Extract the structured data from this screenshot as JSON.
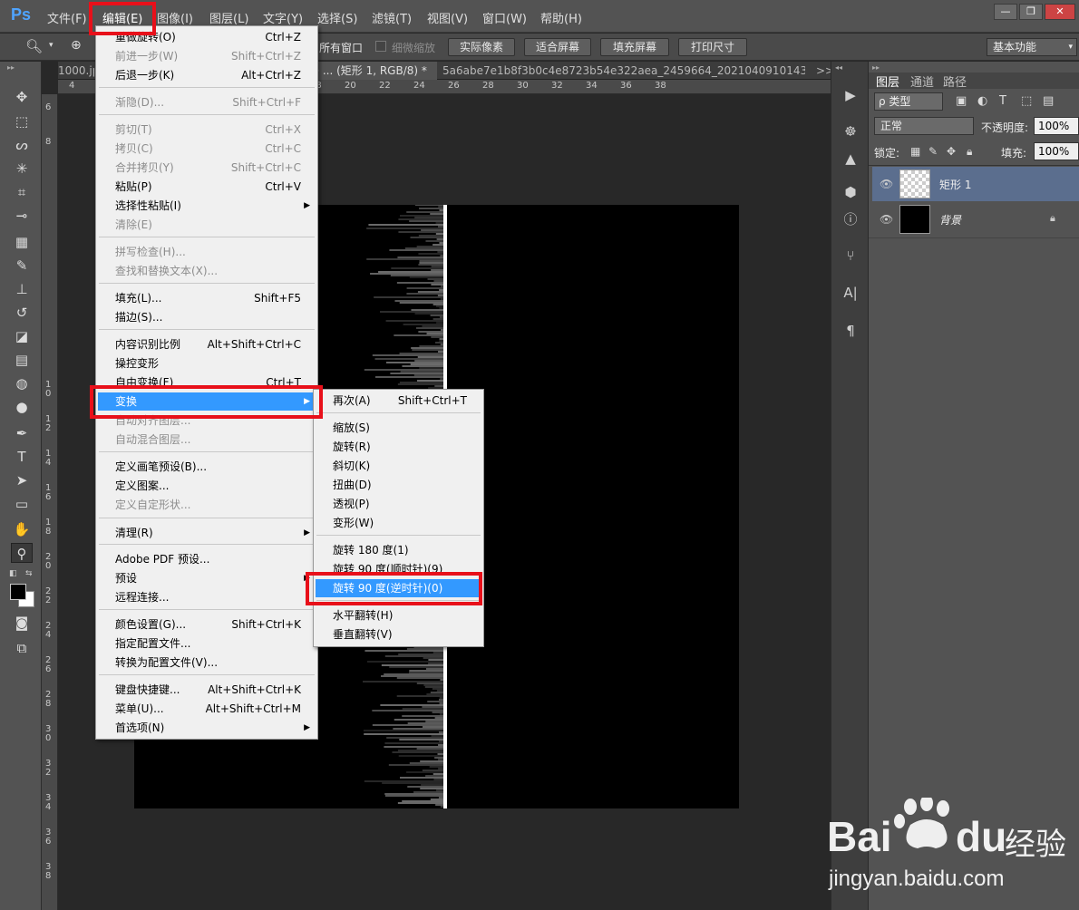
{
  "menubar": {
    "logo": "Ps",
    "items": [
      "文件(F)",
      "编辑(E)",
      "图像(I)",
      "图层(L)",
      "文字(Y)",
      "选择(S)",
      "滤镜(T)",
      "视图(V)",
      "窗口(W)",
      "帮助(H)"
    ],
    "window_controls": [
      "—",
      "❐",
      "✕"
    ]
  },
  "optbar": {
    "all_windows_label": "所有窗口",
    "scrubby_zoom_label": "细微缩放",
    "buttons": [
      "实际像素",
      "适合屏幕",
      "填充屏幕",
      "打印尺寸"
    ],
    "workspace": "基本功能"
  },
  "tabs": {
    "tab1": "1000.jpg",
    "tab2": "@ ... (矩形 1, RGB/8) *",
    "tab3": "5a6abe7e1b8f3b0c4e8723b54e322aea_2459664_202104091014381",
    "overflow": ">>"
  },
  "ruler_top": [
    "4",
    "6",
    "8",
    "10",
    "12",
    "14",
    "16",
    "18",
    "20",
    "22",
    "24",
    "26",
    "28",
    "30",
    "32",
    "34",
    "36",
    "38"
  ],
  "ruler_left": [
    "6",
    "8",
    "1\n0",
    "1\n2",
    "1\n4",
    "1\n6",
    "1\n8",
    "2\n0",
    "2\n2",
    "2\n4",
    "2\n6",
    "2\n8",
    "3\n0",
    "3\n2",
    "3\n4",
    "3\n6",
    "3\n8",
    "4\n0"
  ],
  "edit_menu": {
    "items": [
      {
        "label": "重做旋转(O)",
        "shortcut": "Ctrl+Z",
        "disabled": false
      },
      {
        "label": "前进一步(W)",
        "shortcut": "Shift+Ctrl+Z",
        "disabled": true
      },
      {
        "label": "后退一步(K)",
        "shortcut": "Alt+Ctrl+Z",
        "disabled": false
      },
      {
        "label": "渐隐(D)...",
        "shortcut": "Shift+Ctrl+F",
        "disabled": true
      },
      {
        "label": "剪切(T)",
        "shortcut": "Ctrl+X",
        "disabled": true
      },
      {
        "label": "拷贝(C)",
        "shortcut": "Ctrl+C",
        "disabled": true
      },
      {
        "label": "合并拷贝(Y)",
        "shortcut": "Shift+Ctrl+C",
        "disabled": true
      },
      {
        "label": "粘贴(P)",
        "shortcut": "Ctrl+V",
        "disabled": false
      },
      {
        "label": "选择性粘贴(I)",
        "shortcut": "",
        "disabled": false,
        "submenu": true
      },
      {
        "label": "清除(E)",
        "shortcut": "",
        "disabled": true
      },
      {
        "label": "拼写检查(H)...",
        "shortcut": "",
        "disabled": true
      },
      {
        "label": "查找和替换文本(X)...",
        "shortcut": "",
        "disabled": true
      },
      {
        "label": "填充(L)...",
        "shortcut": "Shift+F5",
        "disabled": false
      },
      {
        "label": "描边(S)...",
        "shortcut": "",
        "disabled": false
      },
      {
        "label": "内容识别比例",
        "shortcut": "Alt+Shift+Ctrl+C",
        "disabled": false
      },
      {
        "label": "操控变形",
        "shortcut": "",
        "disabled": false
      },
      {
        "label": "自由变换(F)",
        "shortcut": "Ctrl+T",
        "disabled": false
      },
      {
        "label": "变换",
        "shortcut": "",
        "disabled": false,
        "submenu": true,
        "highlighted": true
      },
      {
        "label": "自动对齐图层...",
        "shortcut": "",
        "disabled": true
      },
      {
        "label": "自动混合图层...",
        "shortcut": "",
        "disabled": true
      },
      {
        "label": "定义画笔预设(B)...",
        "shortcut": "",
        "disabled": false
      },
      {
        "label": "定义图案...",
        "shortcut": "",
        "disabled": false
      },
      {
        "label": "定义自定形状...",
        "shortcut": "",
        "disabled": true
      },
      {
        "label": "清理(R)",
        "shortcut": "",
        "disabled": false,
        "submenu": true
      },
      {
        "label": "Adobe PDF 预设...",
        "shortcut": "",
        "disabled": false
      },
      {
        "label": "预设",
        "shortcut": "",
        "disabled": false,
        "submenu": true
      },
      {
        "label": "远程连接...",
        "shortcut": "",
        "disabled": false
      },
      {
        "label": "颜色设置(G)...",
        "shortcut": "Shift+Ctrl+K",
        "disabled": false
      },
      {
        "label": "指定配置文件...",
        "shortcut": "",
        "disabled": false
      },
      {
        "label": "转换为配置文件(V)...",
        "shortcut": "",
        "disabled": false
      },
      {
        "label": "键盘快捷键...",
        "shortcut": "Alt+Shift+Ctrl+K",
        "disabled": false
      },
      {
        "label": "菜单(U)...",
        "shortcut": "Alt+Shift+Ctrl+M",
        "disabled": false
      },
      {
        "label": "首选项(N)",
        "shortcut": "",
        "disabled": false,
        "submenu": true
      }
    ]
  },
  "transform_menu": {
    "items": [
      {
        "label": "再次(A)",
        "shortcut": "Shift+Ctrl+T"
      },
      {
        "label": "缩放(S)",
        "shortcut": ""
      },
      {
        "label": "旋转(R)",
        "shortcut": ""
      },
      {
        "label": "斜切(K)",
        "shortcut": ""
      },
      {
        "label": "扭曲(D)",
        "shortcut": ""
      },
      {
        "label": "透视(P)",
        "shortcut": ""
      },
      {
        "label": "变形(W)",
        "shortcut": ""
      },
      {
        "label": "旋转 180 度(1)",
        "shortcut": ""
      },
      {
        "label": "旋转 90 度(顺时针)(9)",
        "shortcut": ""
      },
      {
        "label": "旋转 90 度(逆时针)(0)",
        "shortcut": "",
        "highlighted": true
      },
      {
        "label": "水平翻转(H)",
        "shortcut": ""
      },
      {
        "label": "垂直翻转(V)",
        "shortcut": ""
      }
    ]
  },
  "layers": {
    "tabs": [
      "图层",
      "通道",
      "路径"
    ],
    "filter_kind": "ρ 类型",
    "blend_mode": "正常",
    "opacity_label": "不透明度:",
    "opacity_value": "100%",
    "lock_label": "锁定:",
    "fill_label": "填充:",
    "fill_value": "100%",
    "items": [
      {
        "name": "矩形 1",
        "selected": true
      },
      {
        "name": "背景",
        "locked": true
      }
    ]
  },
  "watermark": {
    "brand": "Bai",
    "brand2": "du",
    "product": "经验",
    "url": "jingyan.baidu.com"
  },
  "colors": {
    "highlight": "#3399ff",
    "annotation": "#e8101a",
    "ps_blue": "#4fa4ff"
  }
}
